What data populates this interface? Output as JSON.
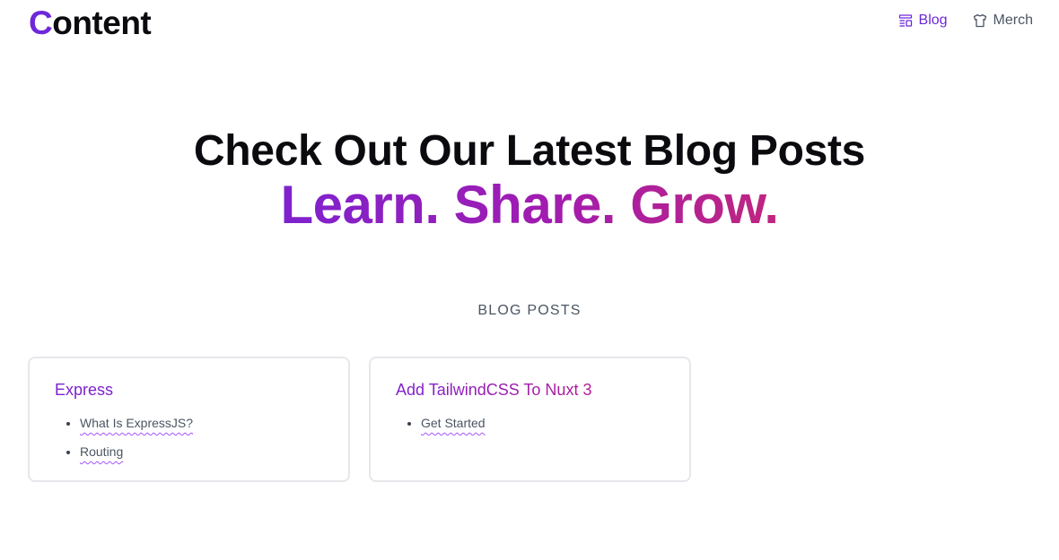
{
  "header": {
    "logo_first": "C",
    "logo_rest": "ontent",
    "nav": [
      {
        "label": "Blog",
        "icon": "blog-icon",
        "active": true
      },
      {
        "label": "Merch",
        "icon": "shirt-icon",
        "active": false
      }
    ]
  },
  "hero": {
    "title": "Check Out Our Latest Blog Posts",
    "tagline": "Learn. Share. Grow."
  },
  "section_label": "BLOG POSTS",
  "cards": [
    {
      "title": "Express",
      "items": [
        "What Is ExpressJS?",
        "Routing"
      ]
    },
    {
      "title": "Add TailwindCSS To Nuxt 3",
      "items": [
        "Get Started"
      ]
    }
  ],
  "colors": {
    "accent": "#6d28d9",
    "gradient_start": "#7e22ce",
    "gradient_end": "#c0267e",
    "card_border": "#e5e7eb"
  }
}
